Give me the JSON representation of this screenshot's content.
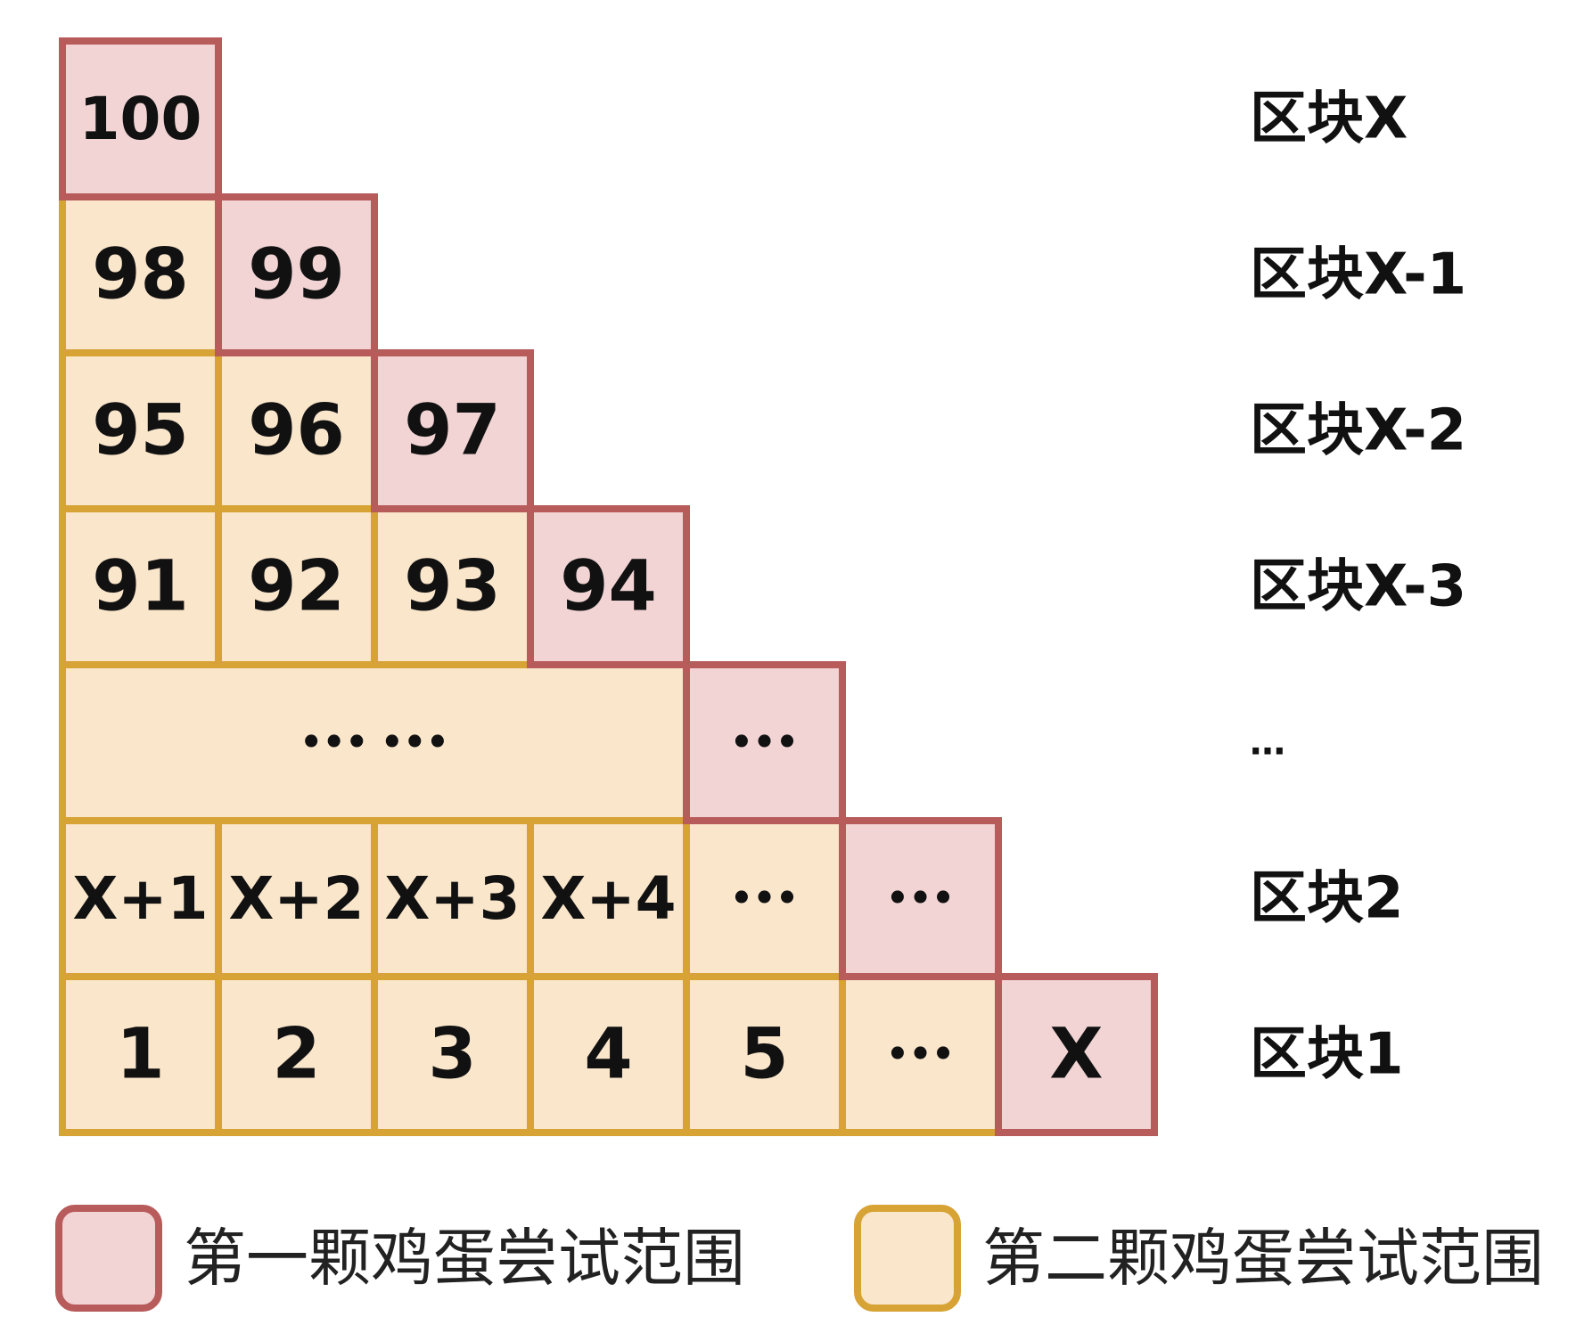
{
  "colors": {
    "first_fill": "#f2d4d4",
    "first_stroke": "#b85b5b",
    "second_fill": "#fae6cb",
    "second_stroke": "#d6a334",
    "text": "#111111"
  },
  "rows": [
    {
      "label": "区块X",
      "cells": [
        {
          "text": "100",
          "type": "first"
        }
      ]
    },
    {
      "label": "区块X-1",
      "cells": [
        {
          "text": "98",
          "type": "second"
        },
        {
          "text": "99",
          "type": "first"
        }
      ]
    },
    {
      "label": "区块X-2",
      "cells": [
        {
          "text": "95",
          "type": "second"
        },
        {
          "text": "96",
          "type": "second"
        },
        {
          "text": "97",
          "type": "first"
        }
      ]
    },
    {
      "label": "区块X-3",
      "cells": [
        {
          "text": "91",
          "type": "second"
        },
        {
          "text": "92",
          "type": "second"
        },
        {
          "text": "93",
          "type": "second"
        },
        {
          "text": "94",
          "type": "first"
        }
      ]
    },
    {
      "label": "…",
      "cells": [
        {
          "text": "••• •••",
          "type": "second",
          "span": 4
        },
        {
          "text": "•••",
          "type": "first"
        }
      ]
    },
    {
      "label": "区块2",
      "cells": [
        {
          "text": "X+1",
          "type": "second"
        },
        {
          "text": "X+2",
          "type": "second"
        },
        {
          "text": "X+3",
          "type": "second"
        },
        {
          "text": "X+4",
          "type": "second"
        },
        {
          "text": "•••",
          "type": "second"
        },
        {
          "text": "•••",
          "type": "first"
        }
      ]
    },
    {
      "label": "区块1",
      "cells": [
        {
          "text": "1",
          "type": "second"
        },
        {
          "text": "2",
          "type": "second"
        },
        {
          "text": "3",
          "type": "second"
        },
        {
          "text": "4",
          "type": "second"
        },
        {
          "text": "5",
          "type": "second"
        },
        {
          "text": "•••",
          "type": "second"
        },
        {
          "text": "X",
          "type": "first"
        }
      ]
    }
  ],
  "legend": [
    {
      "type": "first",
      "label": "第一颗鸡蛋尝试范围"
    },
    {
      "type": "second",
      "label": "第二颗鸡蛋尝试范围"
    }
  ]
}
